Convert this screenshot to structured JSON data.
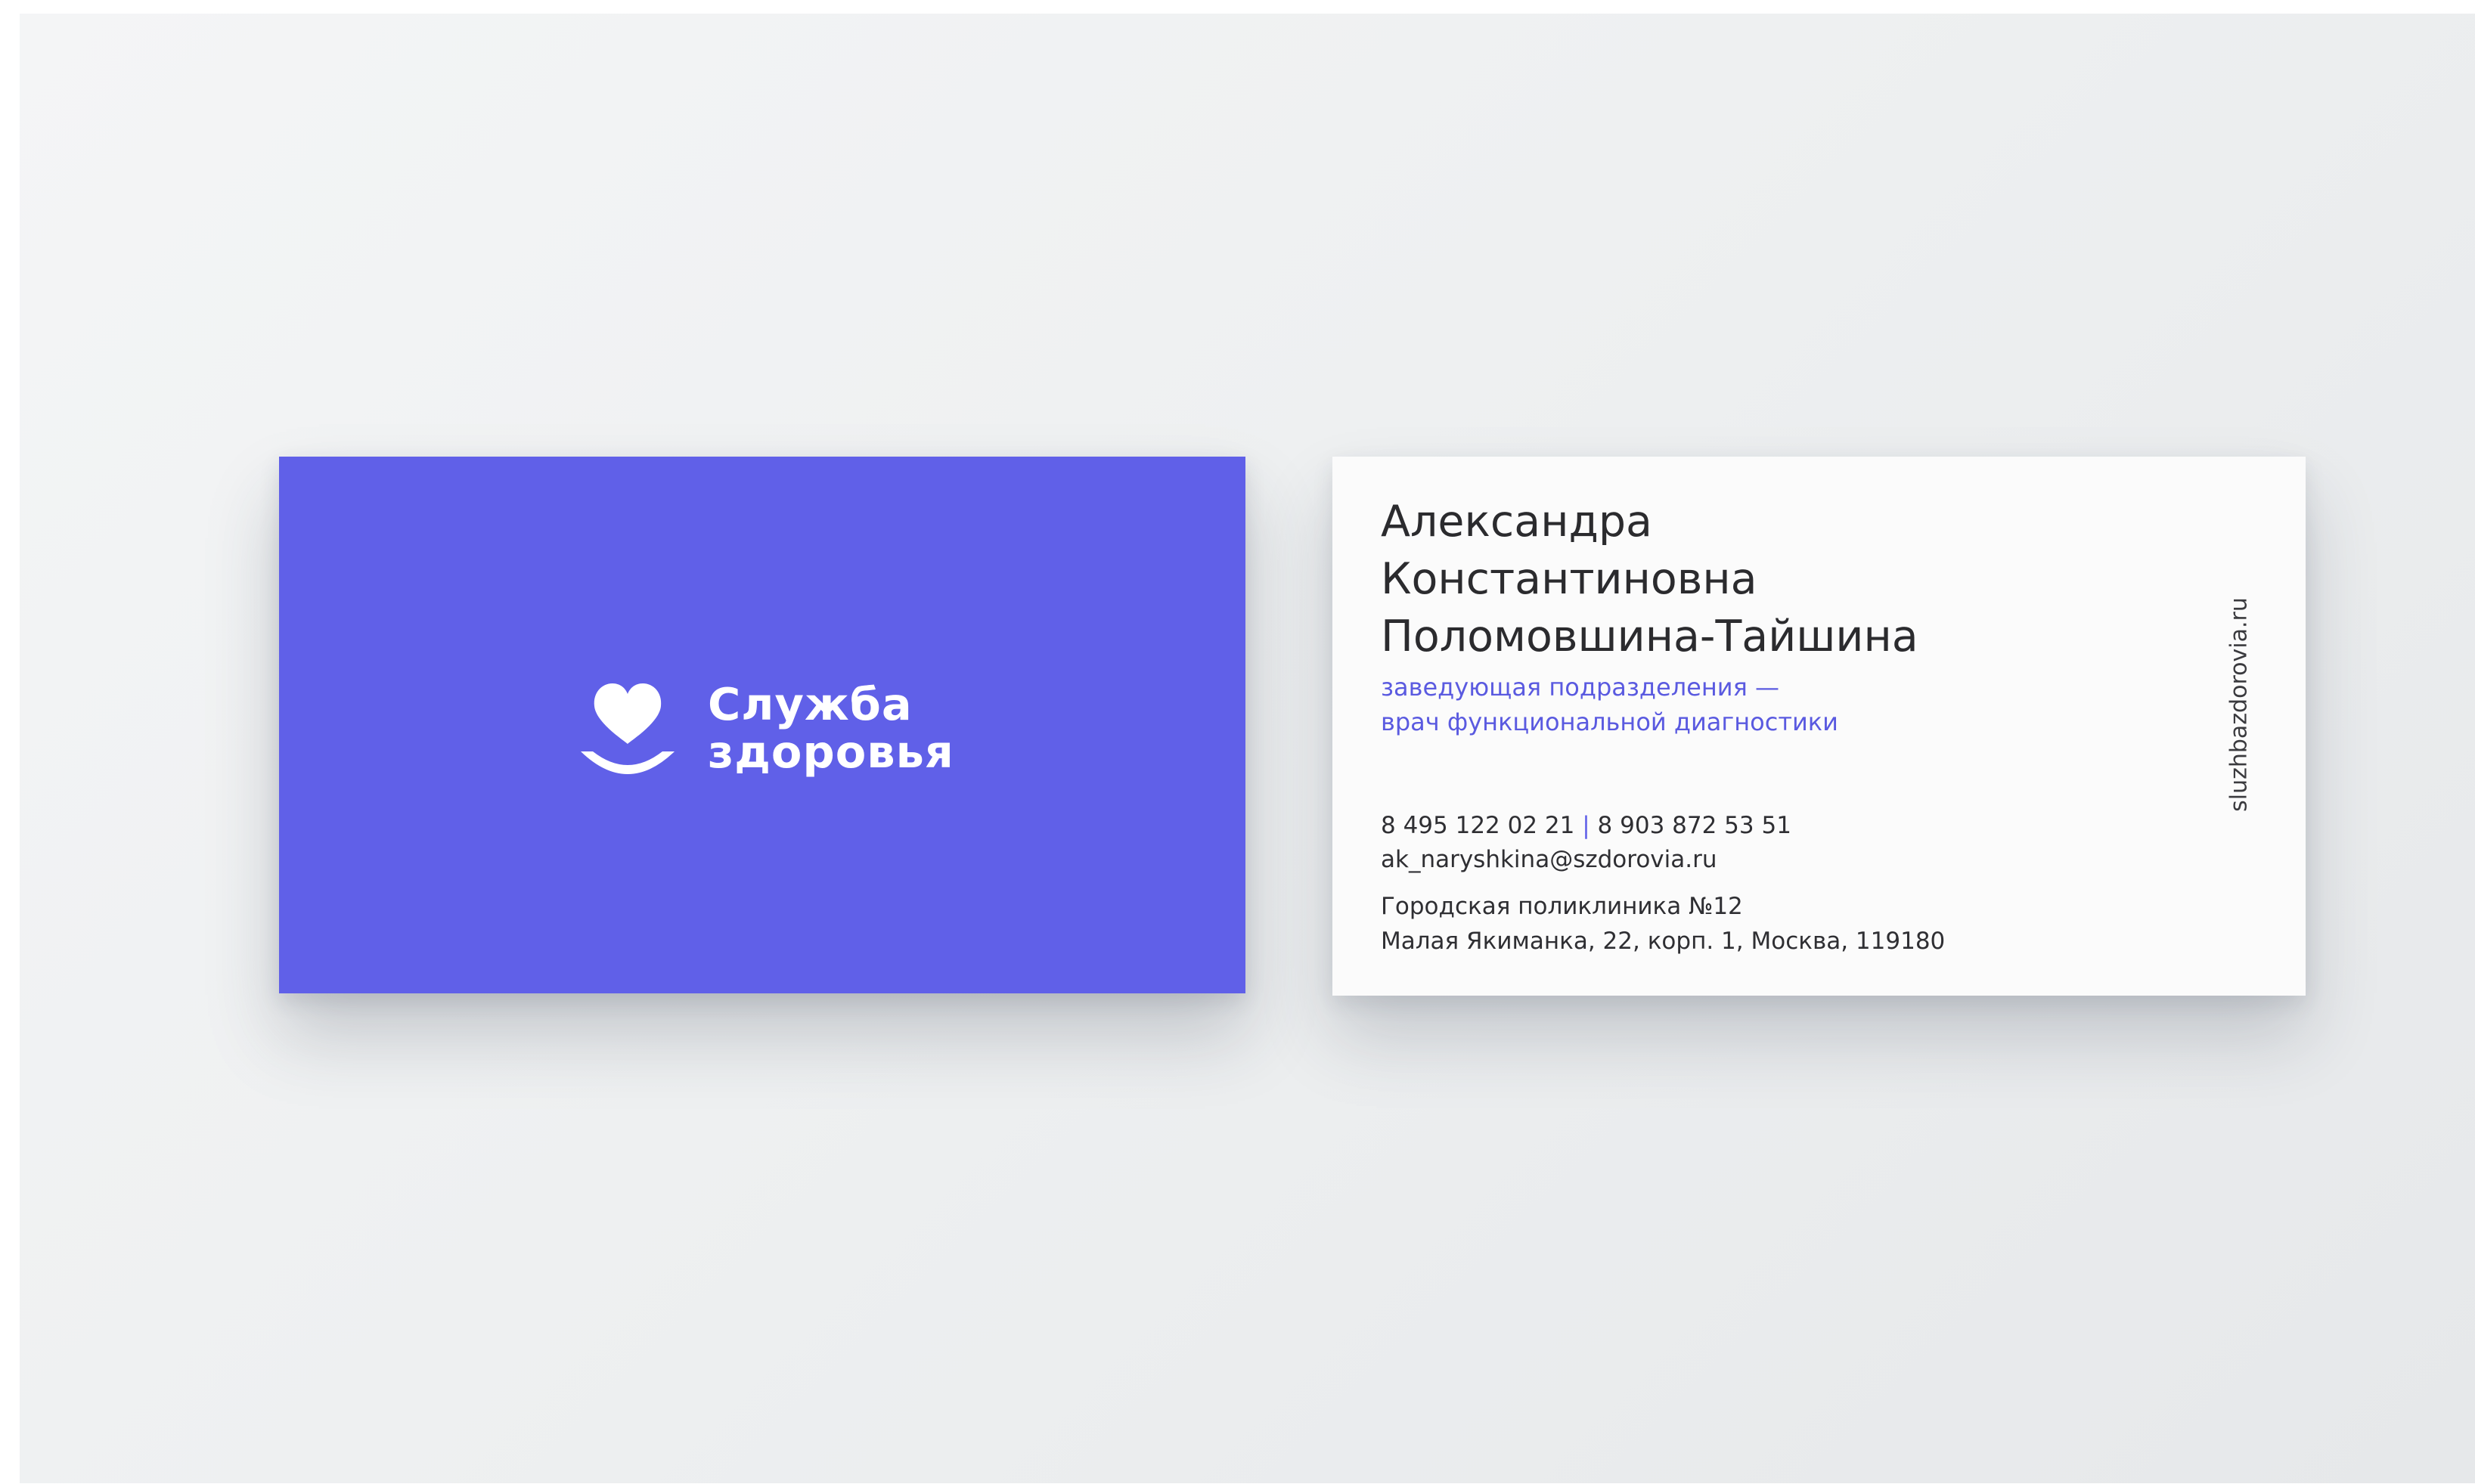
{
  "front": {
    "logo": {
      "icon": "heart-smile-icon",
      "line1": "Служба",
      "line2": "здоровья"
    },
    "color": "#6060e8"
  },
  "back": {
    "name": {
      "first": "Александра",
      "middle": "Константиновна",
      "last": "Поломовшина-Тайшина"
    },
    "position": {
      "line1": "заведующая подразделения —",
      "line2": "врач функциональной диагностики"
    },
    "contacts": {
      "phone1": "8 495 122 02 21",
      "separator": "|",
      "phone2": "8 903 872 53 51",
      "email": "ak_naryshkina@szdorovia.ru"
    },
    "address": {
      "organization": "Городская поликлиника №12",
      "street": "Малая Якиманка, 22, корп. 1, Москва, 119180"
    },
    "website": "sluzhbazdorovia.ru",
    "accent": "#5a5ae0"
  }
}
